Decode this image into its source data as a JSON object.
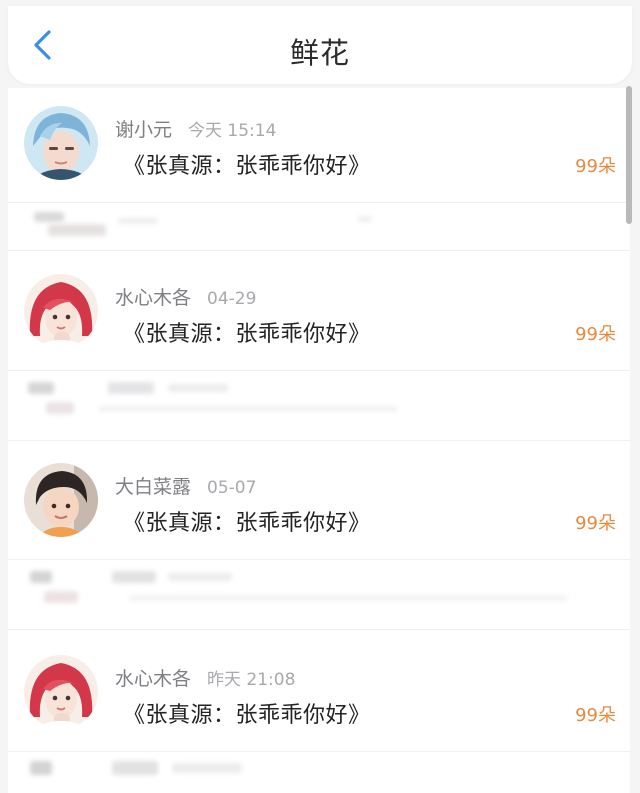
{
  "header": {
    "title": "鲜花",
    "back_icon": "chevron-left-icon",
    "accent_color": "#3a8fe6"
  },
  "gifts": [
    {
      "name": "谢小元",
      "time": "今天 15:14",
      "work": "《张真源：张乖乖你好》",
      "flowers": "99朵",
      "avatar_icon": "avatar-blue-hair"
    },
    {
      "name": "水心木各",
      "time": "04-29",
      "work": "《张真源：张乖乖你好》",
      "flowers": "99朵",
      "avatar_icon": "avatar-red-hair"
    },
    {
      "name": "大白菜露",
      "time": "05-07",
      "work": "《张真源：张乖乖你好》",
      "flowers": "99朵",
      "avatar_icon": "avatar-dark-hair"
    },
    {
      "name": "水心木各",
      "time": "昨天 21:08",
      "work": "《张真源：张乖乖你好》",
      "flowers": "99朵",
      "avatar_icon": "avatar-red-hair"
    }
  ],
  "colors": {
    "flower_count": "#e78a3e",
    "name": "#7f7f84",
    "time": "#a9a9ad"
  }
}
